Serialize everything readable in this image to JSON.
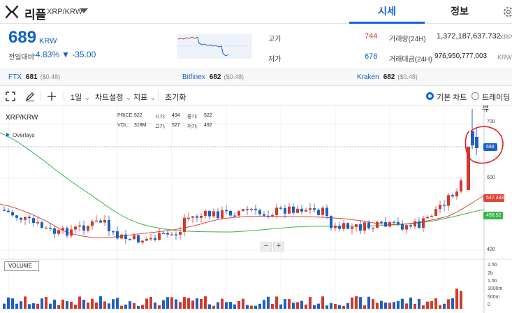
{
  "header": {
    "coin_name": "리플",
    "pair": "XRP/KRW",
    "tabs": [
      {
        "label": "시세",
        "active": true
      },
      {
        "label": "정보",
        "active": false
      }
    ]
  },
  "ticker": {
    "price": "689",
    "unit": "KRW",
    "change_label": "전일대비",
    "change_percent": "-4.83%",
    "change_value": "▼ -35.00"
  },
  "stats": {
    "high_label": "고가",
    "high_value": "744",
    "low_label": "저가",
    "low_value": "678",
    "volume_label": "거래량(24H)",
    "volume_value": "1,372,187,637.732",
    "volume_unit": "XRP",
    "amount_label": "거래대금(24H)",
    "amount_value": "976,950,777,003",
    "amount_unit": "KRW"
  },
  "exchanges": [
    {
      "name": "FTX",
      "price": "681",
      "usd": "($0.48)"
    },
    {
      "name": "Bitfinex",
      "price": "682",
      "usd": "($0.48)"
    },
    {
      "name": "Kraken",
      "price": "682",
      "usd": "($0.48)"
    }
  ],
  "toolbar": {
    "interval": "1일",
    "chart_settings": "차트설정",
    "indicators": "지표",
    "reset": "초기화",
    "basic_chart": "기본 차트",
    "tradingview": "트레이딩뷰"
  },
  "chart": {
    "symbol": "XRP/KRW",
    "overlays": "Overlays",
    "info": {
      "price_label": "PRICE:",
      "price": "522",
      "vol_label": "VOL:",
      "vol": "318M",
      "open_label": "시가:",
      "open": "494",
      "high_label": "고가:",
      "high": "527",
      "close_label": "종가:",
      "close": "522",
      "low_label": "저가:",
      "low": "492"
    },
    "volume_label": "VOLUME",
    "zoom_out": "−",
    "zoom_in": "+",
    "price_axis": [
      "700",
      "600",
      "400"
    ],
    "volume_axis": [
      "2.5b",
      "2b",
      "1.5b",
      "1000m",
      "500m",
      "0"
    ],
    "last_price_badge": "689",
    "ma_short_badge": "547.333",
    "ma_long_badge": "498.52",
    "colors": {
      "up": "#d23a2c",
      "down": "#1f5fc4",
      "ma_short": "#e0463a",
      "ma_long": "#39b54a",
      "accent": "#1263d6"
    }
  }
}
